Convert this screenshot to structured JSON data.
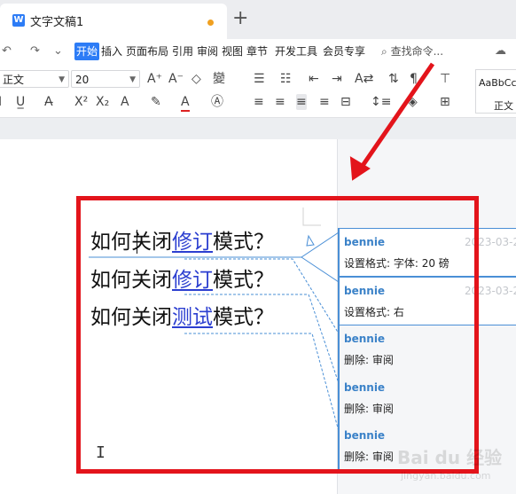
{
  "window": {
    "tab_title": "文字文稿1",
    "tab_icon": "W",
    "new_tab_symbol": "+"
  },
  "menu": {
    "quick_access": [
      "↶",
      "↷",
      "⌄"
    ],
    "tabs": [
      "开始",
      "插入",
      "页面布局",
      "引用",
      "审阅",
      "视图",
      "章节",
      "开发工具",
      "会员专享"
    ],
    "active_tab": "开始",
    "search_placeholder": "查找命令..."
  },
  "ribbon": {
    "style_combo": "正文",
    "size_combo": "20",
    "style_gallery_preview": "AaBbCc",
    "style_gallery_label": "正文"
  },
  "document": {
    "lines": [
      {
        "before": "如何关闭",
        "revised": "修订",
        "after": "模式？"
      },
      {
        "before": "如何关闭",
        "revised": "修订",
        "after": "模式？"
      },
      {
        "before": "如何关闭",
        "revised": "测试",
        "after": "模式？"
      }
    ]
  },
  "comments": [
    {
      "author": "bennie",
      "date": "2023-03-2",
      "text": "设置格式: 字体: 20 磅"
    },
    {
      "author": "bennie",
      "date": "2023-03-2",
      "text": "设置格式: 右"
    },
    {
      "author": "bennie",
      "text": "删除: 审阅"
    },
    {
      "author": "bennie",
      "text": "删除: 审阅"
    },
    {
      "author": "bennie",
      "text": "删除: 审阅"
    }
  ],
  "annotation": {
    "frame_color": "#e3141b",
    "arrow_color": "#e3141b"
  },
  "watermark": {
    "text": "Bai du 经验",
    "sub": "jingyan.baidu.com"
  },
  "colors": {
    "accent": "#2d7cf6",
    "revision_text": "#2c3fd0",
    "comment_line": "#4a8fd6",
    "comment_author": "#3b82c8"
  }
}
